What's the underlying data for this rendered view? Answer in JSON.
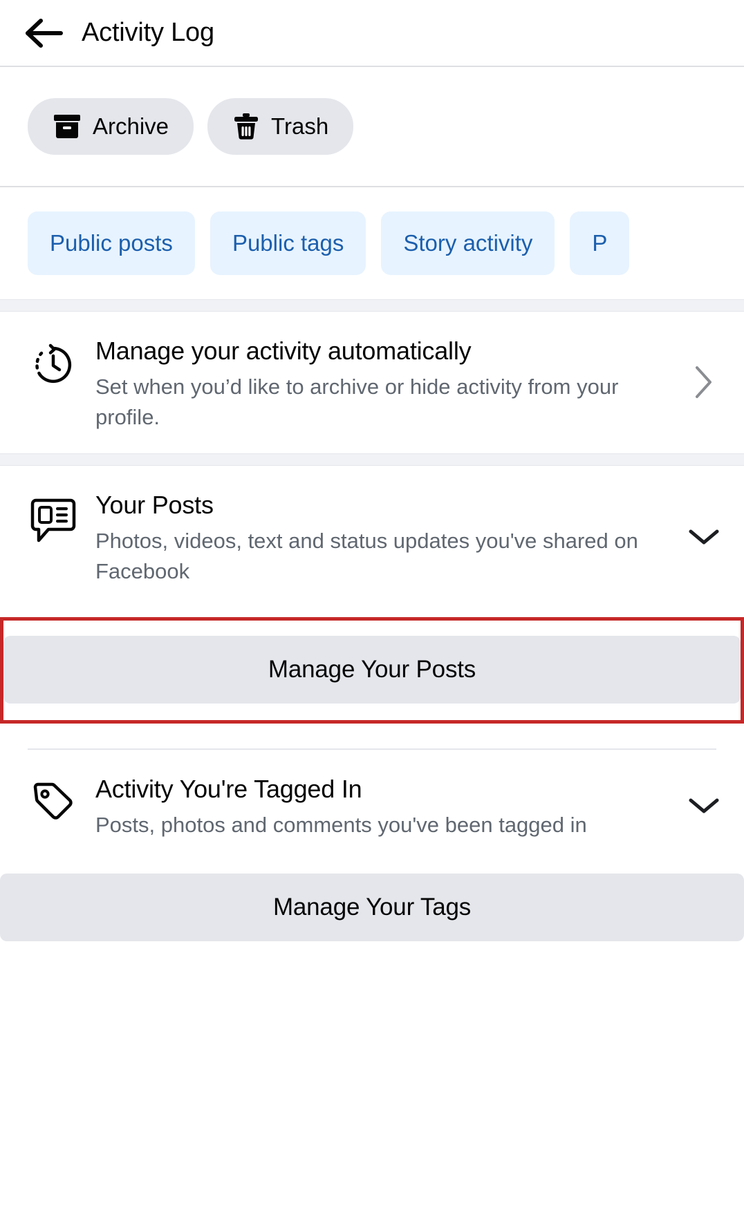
{
  "header": {
    "title": "Activity Log",
    "back_icon": "arrow-left-icon"
  },
  "toolbar": {
    "buttons": [
      {
        "label": "Archive",
        "icon": "archive-box-icon"
      },
      {
        "label": "Trash",
        "icon": "trash-can-icon"
      }
    ]
  },
  "filters": {
    "chips": [
      {
        "label": "Public posts"
      },
      {
        "label": "Public tags"
      },
      {
        "label": "Story activity"
      },
      {
        "label": "P"
      }
    ]
  },
  "sections": {
    "auto_manage": {
      "icon": "clock-history-icon",
      "title": "Manage your activity automatically",
      "subtitle": "Set when you’d like to archive or hide activity from your profile.",
      "chevron": "chevron-right-icon"
    },
    "your_posts": {
      "icon": "post-bubble-icon",
      "title": "Your Posts",
      "subtitle": "Photos, videos, text and status updates you've shared on Facebook",
      "chevron": "chevron-down-icon",
      "button_label": "Manage Your Posts",
      "highlighted": true
    },
    "tagged_in": {
      "icon": "tag-icon",
      "title": "Activity You're Tagged In",
      "subtitle": "Posts, photos and comments you've been tagged in",
      "chevron": "chevron-down-icon",
      "button_label": "Manage Your Tags",
      "highlighted": false
    }
  },
  "colors": {
    "chip_bg": "#e7f3ff",
    "chip_text": "#1c5fad",
    "pill_bg": "#e4e6eb",
    "highlight_border": "#c62828",
    "text_primary": "#050505",
    "text_secondary": "#606770"
  }
}
